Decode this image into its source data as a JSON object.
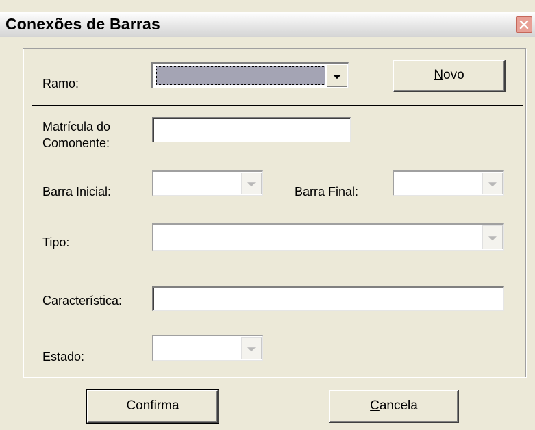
{
  "window": {
    "title": "Conexões de Barras"
  },
  "form": {
    "ramo": {
      "label": "Ramo:",
      "value": ""
    },
    "novo_button": {
      "label_mnemonic": "N",
      "label_rest": "ovo"
    },
    "matricula": {
      "label_line1": "Matrícula do",
      "label_line2": "Comonente:",
      "value": ""
    },
    "barra_inicial": {
      "label": "Barra Inicial:",
      "value": ""
    },
    "barra_final": {
      "label": "Barra Final:",
      "value": ""
    },
    "tipo": {
      "label": "Tipo:",
      "value": ""
    },
    "caracteristica": {
      "label": "Característica:",
      "value": ""
    },
    "estado": {
      "label": "Estado:",
      "value": ""
    }
  },
  "buttons": {
    "confirma": {
      "label": "Confirma"
    },
    "cancela": {
      "label_mnemonic": "C",
      "label_rest": "ancela"
    }
  },
  "icons": {
    "close": "close-icon",
    "dropdown": "chevron-down-icon"
  },
  "colors": {
    "dialog_bg": "#ece9d8",
    "close_button": "#e8a096",
    "selection": "#a4a4b4"
  }
}
